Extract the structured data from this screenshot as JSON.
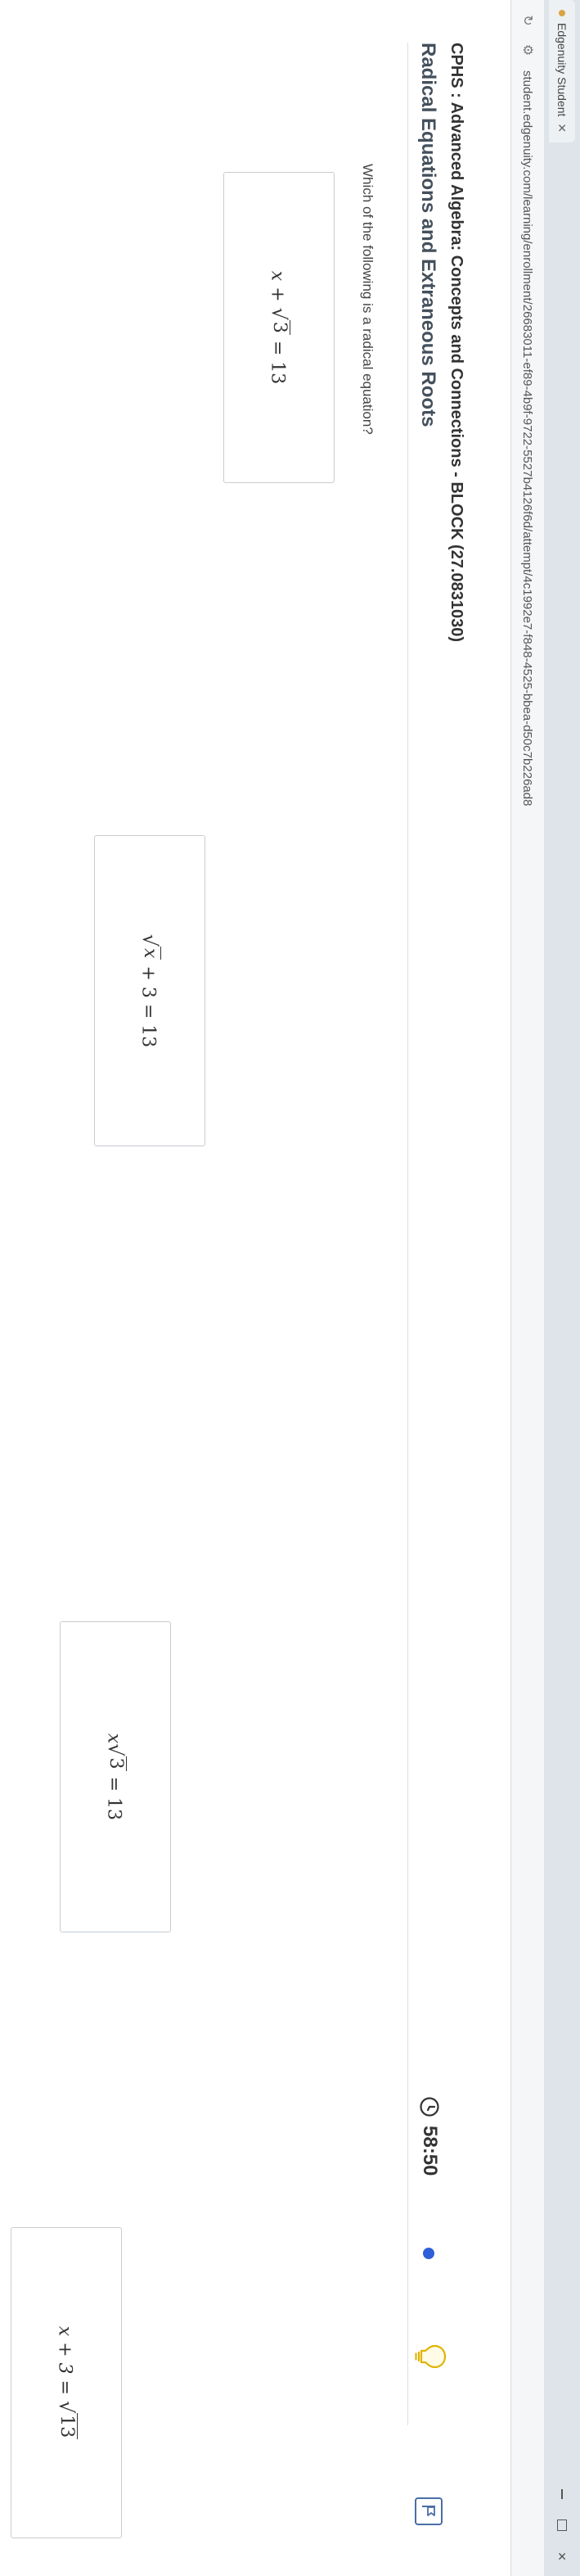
{
  "browser": {
    "tab_title": "Edgenuity Student",
    "url": "student.edgenuity.com/learning/enrollment/26683011-ef89-4b9f-9722-5527b4126f6d/attempt/4c1992e7-f848-4525-bbea-d50c7b226ad8"
  },
  "course": {
    "title": "CPHS : Advanced Algebra: Concepts and Connections - BLOCK (27.0831030)",
    "lesson_title": "Radical Equations and Extraneous Roots"
  },
  "timer": {
    "value": "58:50"
  },
  "question": {
    "prompt": "Which of the following is a radical equation?"
  },
  "choices": [
    {
      "id": "a",
      "left_var": "x",
      "op1": " + ",
      "radicand": "3",
      "rest": " = 13"
    },
    {
      "id": "b",
      "radicand": "x",
      "rest": " + 3 = 13"
    },
    {
      "id": "c",
      "left_var": "x",
      "radicand": "3",
      "rest": " = 13"
    },
    {
      "id": "d",
      "lhs": "x + 3 = ",
      "radicand": "13"
    }
  ],
  "colors": {
    "progress_dot": "#2e5fd8",
    "flag_border": "#4a6fa5",
    "hint_outline": "#e0b400"
  },
  "icons": {
    "timer": "clock-icon",
    "hint": "lightbulb-icon",
    "flag": "flag-icon"
  }
}
